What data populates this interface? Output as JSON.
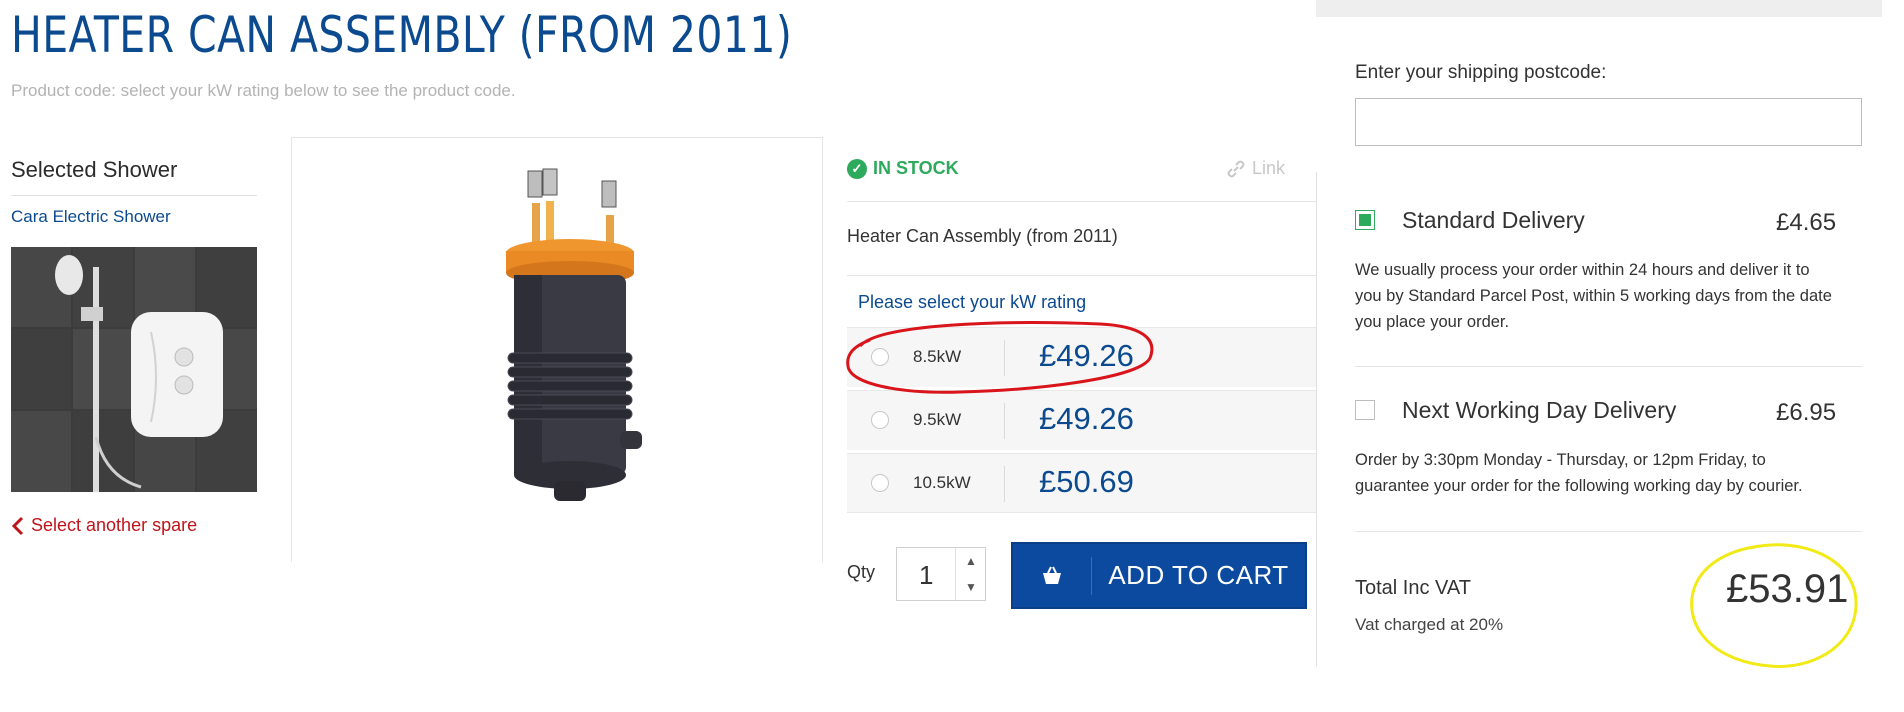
{
  "product": {
    "title": "HEATER CAN ASSEMBLY (FROM 2011)",
    "code_hint": "Product code: select your kW rating below to see the product code.",
    "stock_status": "IN STOCK",
    "link_label": "Link",
    "name": "Heater Can Assembly (from 2011)",
    "kw_prompt": "Please select your kW rating",
    "options": [
      {
        "kw": "8.5kW",
        "price": "£49.26",
        "selected": false
      },
      {
        "kw": "9.5kW",
        "price": "£49.26",
        "selected": false
      },
      {
        "kw": "10.5kW",
        "price": "£50.69",
        "selected": false
      }
    ],
    "qty_label": "Qty",
    "qty_value": "1",
    "add_to_cart": "ADD TO CART"
  },
  "selected_shower": {
    "heading": "Selected Shower",
    "name": "Cara Electric Shower",
    "back_link": "Select another spare"
  },
  "shipping": {
    "postcode_label": "Enter your shipping postcode:",
    "postcode_value": "",
    "options": [
      {
        "name": "Standard Delivery",
        "price": "£4.65",
        "checked": true,
        "description": "We usually process your order within 24 hours and deliver it to you by Standard Parcel Post, within 5 working days from the date you place your order."
      },
      {
        "name": "Next Working Day Delivery",
        "price": "£6.95",
        "checked": false,
        "description": "Order by 3:30pm Monday - Thursday, or 12pm Friday, to guarantee your order for the following working day by courier."
      }
    ],
    "total_label": "Total Inc VAT",
    "vat_note": "Vat charged at 20%",
    "total_price": "£53.91"
  },
  "colors": {
    "brand_blue": "#0b4a8f",
    "stock_green": "#2eaa5c",
    "back_red": "#c0141b",
    "annotation_red": "#d9141b",
    "annotation_yellow": "#f2ea16"
  },
  "icons": [
    "check-circle-icon",
    "link-icon",
    "chevron-left-icon",
    "shopping-bag-icon",
    "chevron-up-icon",
    "chevron-down-icon"
  ]
}
